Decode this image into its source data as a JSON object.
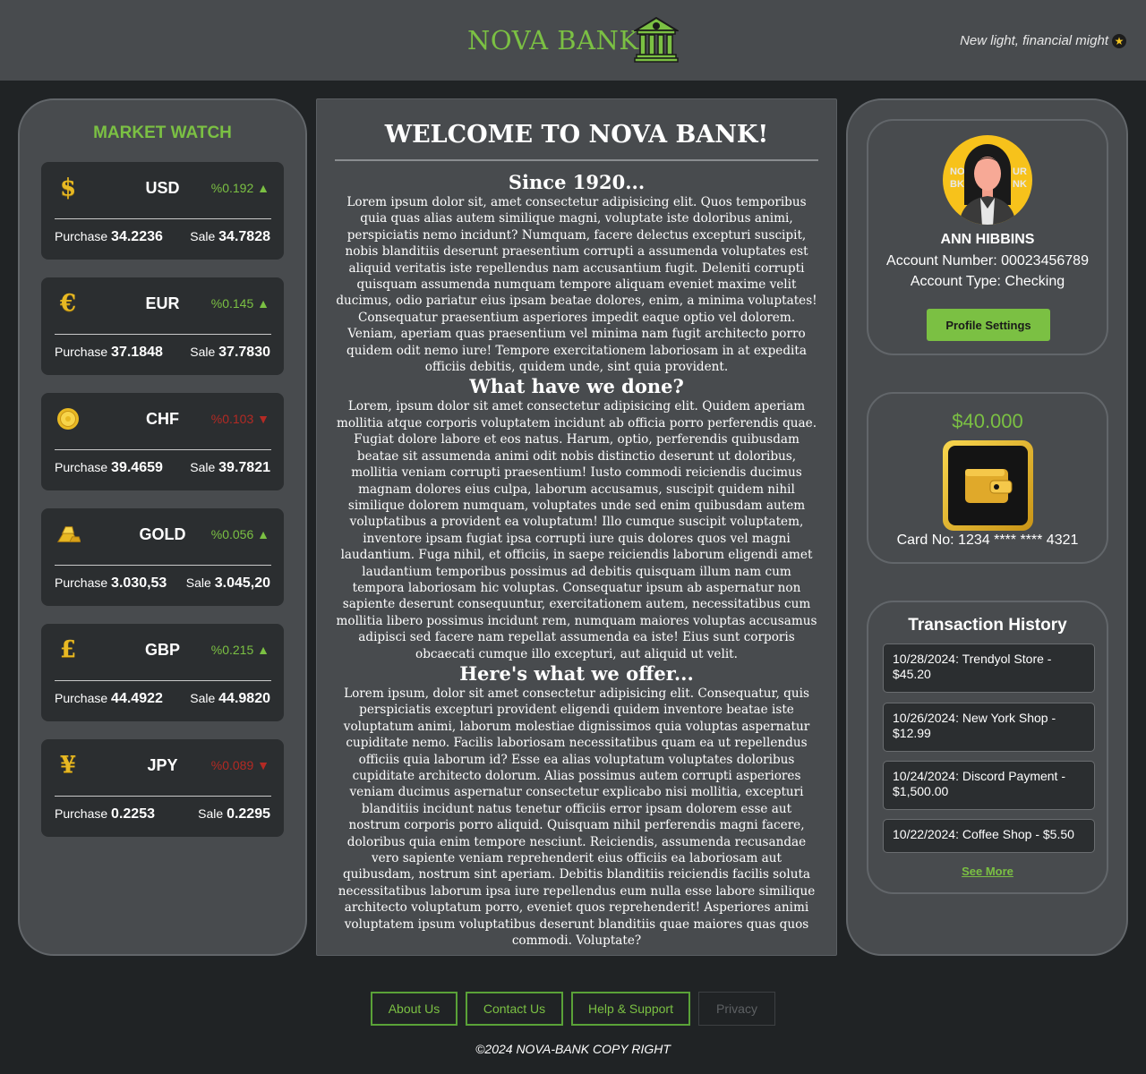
{
  "header": {
    "brand": "NOVA BANK",
    "tagline": "New light, financial might",
    "accent_color": "#7bc043"
  },
  "market_watch": {
    "title": "MARKET WATCH",
    "purchase_label": "Purchase",
    "sale_label": "Sale",
    "items": [
      {
        "icon": "dollar-icon",
        "glyph": "$",
        "code": "USD",
        "change": "%0.192 ▲",
        "trend": "up",
        "purchase": "34.2236",
        "sale": "34.7828"
      },
      {
        "icon": "euro-icon",
        "glyph": "€",
        "code": "EUR",
        "change": "%0.145 ▲",
        "trend": "up",
        "purchase": "37.1848",
        "sale": "37.7830"
      },
      {
        "icon": "coin-icon",
        "glyph": "",
        "code": "CHF",
        "change": "%0.103 ▼",
        "trend": "down",
        "purchase": "39.4659",
        "sale": "39.7821"
      },
      {
        "icon": "gold-bars-icon",
        "glyph": "",
        "code": "GOLD",
        "change": "%0.056 ▲",
        "trend": "up",
        "purchase": "3.030,53",
        "sale": "3.045,20"
      },
      {
        "icon": "pound-icon",
        "glyph": "£",
        "code": "GBP",
        "change": "%0.215 ▲",
        "trend": "up",
        "purchase": "44.4922",
        "sale": "44.9820"
      },
      {
        "icon": "yen-icon",
        "glyph": "¥",
        "code": "JPY",
        "change": "%0.089 ▼",
        "trend": "down",
        "purchase": "0.2253",
        "sale": "0.2295"
      }
    ]
  },
  "main": {
    "title": "WELCOME TO NOVA BANK!",
    "sections": [
      {
        "heading": "Since 1920...",
        "text": "Lorem ipsum dolor sit, amet consectetur adipisicing elit. Quos temporibus quia quas alias autem similique magni, voluptate iste doloribus animi, perspiciatis nemo incidunt? Numquam, facere delectus excepturi suscipit, nobis blanditiis deserunt praesentium corrupti a assumenda voluptates est aliquid veritatis iste repellendus nam accusantium fugit. Deleniti corrupti quisquam assumenda numquam tempore aliquam eveniet maxime velit ducimus, odio pariatur eius ipsam beatae dolores, enim, a minima voluptates! Consequatur praesentium asperiores impedit eaque optio vel dolorem. Veniam, aperiam quas praesentium vel minima nam fugit architecto porro quidem odit nemo iure! Tempore exercitationem laboriosam in at expedita officiis debitis, quidem unde, sint quia provident."
      },
      {
        "heading": "What have we done?",
        "text": "Lorem, ipsum dolor sit amet consectetur adipisicing elit. Quidem aperiam mollitia atque corporis voluptatem incidunt ab officia porro perferendis quae. Fugiat dolore labore et eos natus. Harum, optio, perferendis quibusdam beatae sit assumenda animi odit nobis distinctio deserunt ut doloribus, mollitia veniam corrupti praesentium! Iusto commodi reiciendis ducimus magnam dolores eius culpa, laborum accusamus, suscipit quidem nihil similique dolorem numquam, voluptates unde sed enim quibusdam autem voluptatibus a provident ea voluptatum! Illo cumque suscipit voluptatem, inventore ipsam fugiat ipsa corrupti iure quis dolores quos vel magni laudantium. Fuga nihil, et officiis, in saepe reiciendis laborum eligendi amet laudantium temporibus possimus ad debitis quisquam illum nam cum tempora laboriosam hic voluptas. Consequatur ipsum ab aspernatur non sapiente deserunt consequuntur, exercitationem autem, necessitatibus cum mollitia libero possimus incidunt rem, numquam maiores voluptas accusamus adipisci sed facere nam repellat assumenda ea iste! Eius sunt corporis obcaecati cumque illo excepturi, aut aliquid ut velit."
      },
      {
        "heading": "Here's what we offer...",
        "text": "Lorem ipsum, dolor sit amet consectetur adipisicing elit. Consequatur, quis perspiciatis excepturi provident eligendi quidem inventore beatae iste voluptatum animi, laborum molestiae dignissimos quia voluptas aspernatur cupiditate nemo. Facilis laboriosam necessitatibus quam ea ut repellendus officiis quia laborum id? Esse ea alias voluptatum voluptates doloribus cupiditate architecto dolorum. Alias possimus autem corrupti asperiores veniam ducimus aspernatur consectetur explicabo nisi mollitia, excepturi blanditiis incidunt natus tenetur officiis error ipsam dolorem esse aut nostrum corporis porro aliquid. Quisquam nihil perferendis magni facere, doloribus quia enim tempore nesciunt. Reiciendis, assumenda recusandae vero sapiente veniam reprehenderit eius officiis ea laboriosam aut quibusdam, nostrum sint aperiam. Debitis blanditiis reiciendis facilis soluta necessitatibus laborum ipsa iure repellendus eum nulla esse labore similique architecto voluptatum porro, eveniet quos reprehenderit! Asperiores animi voluptatem ipsum voluptatibus deserunt blanditiis quae maiores quas quos commodi. Voluptate?"
      }
    ]
  },
  "profile": {
    "name": "ANN HIBBINS",
    "account_number": "Account Number: 00023456789",
    "account_type": "Account Type: Checking",
    "settings_button": "Profile Settings",
    "avatar_text_left": "NO\nBK",
    "avatar_text_right": "UR\nNK"
  },
  "balance": {
    "amount": "$40.000",
    "card_number": "Card No: 1234 **** **** 4321"
  },
  "transactions": {
    "title": "Transaction History",
    "items": [
      "10/28/2024: Trendyol Store - $45.20",
      "10/26/2024: New York Shop - $12.99",
      "10/24/2024: Discord Payment - $1,500.00",
      "10/22/2024: Coffee Shop - $5.50"
    ],
    "see_more": "See More"
  },
  "footer": {
    "links": [
      "About Us",
      "Contact Us",
      "Help & Support",
      "Privacy"
    ],
    "copyright": "©2024 NOVA-BANK COPY RIGHT"
  }
}
